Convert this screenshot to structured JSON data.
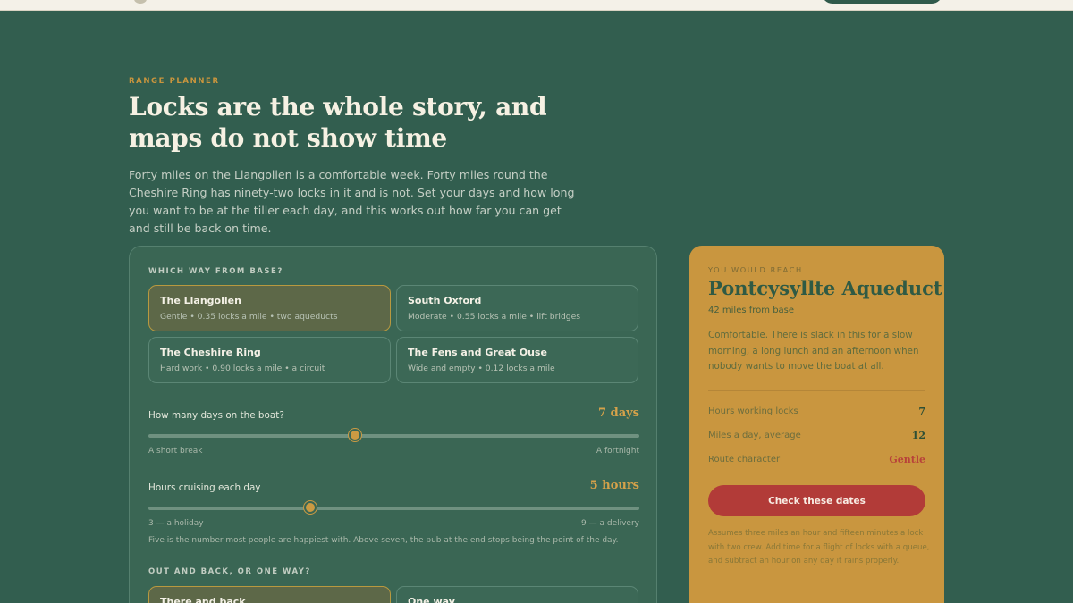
{
  "intro": {
    "eyebrow": "RANGE PLANNER",
    "headline": "Locks are the whole story, and maps do not show time",
    "body": "Forty miles on the Llangollen is a comfortable week. Forty miles round the Cheshire Ring has ninety-two locks in it and is not. Set your days and how long you want to be at the tiller each day, and this works out how far you can get and still be back on time."
  },
  "planner": {
    "route_heading": "WHICH WAY FROM BASE?",
    "routes": [
      {
        "name": "The Llangollen",
        "desc": "Gentle • 0.35 locks a mile • two aqueducts",
        "selected": true
      },
      {
        "name": "South Oxford",
        "desc": "Moderate • 0.55 locks a mile • lift bridges",
        "selected": false
      },
      {
        "name": "The Cheshire Ring",
        "desc": "Hard work • 0.90 locks a mile • a circuit",
        "selected": false
      },
      {
        "name": "The Fens and Great Ouse",
        "desc": "Wide and empty • 0.12 locks a mile",
        "selected": false
      }
    ],
    "days": {
      "label": "How many days on the boat?",
      "value": "7 days",
      "level": 0.42,
      "min_label": "A short break",
      "max_label": "A fortnight"
    },
    "hours": {
      "label": "Hours cruising each day",
      "value": "5 hours",
      "level": 0.33,
      "min_label": "3 — a holiday",
      "max_label": "9 — a delivery",
      "hint": "Five is the number most people are happiest with. Above seven, the pub at the end stops being the point of the day."
    },
    "trip_heading": "OUT AND BACK, OR ONE WAY?",
    "trips": [
      {
        "label": "There and back",
        "selected": true
      },
      {
        "label": "One way",
        "selected": false
      }
    ]
  },
  "result": {
    "eyebrow": "YOU WOULD REACH",
    "place": "Pontcysyllte Aqueduct",
    "distance": "42 miles from base",
    "body": "Comfortable. There is slack in this for a slow morning, a long lunch and an afternoon when nobody wants to move the boat at all.",
    "stats": [
      {
        "label": "Hours working locks",
        "value": "7"
      },
      {
        "label": "Miles a day, average",
        "value": "12"
      },
      {
        "label": "Route character",
        "value": "Gentle"
      }
    ],
    "cta": "Check these dates",
    "footnote": "Assumes three miles an hour and fifteen minutes a lock with two crew. Add time for a flight of locks with a queue, and subtract an hour on any day it rains properly."
  },
  "colors": {
    "background": "#325e4f",
    "accent_gold": "#c9963f",
    "cta_red": "#b23b38"
  }
}
